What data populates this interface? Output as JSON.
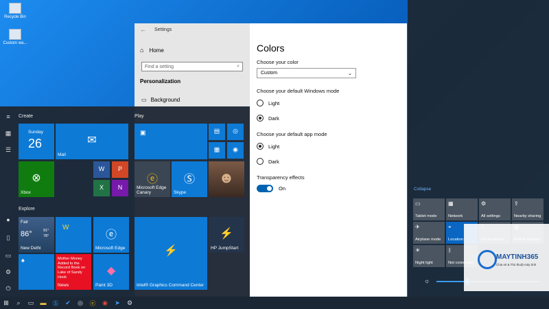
{
  "desktop": {
    "icons": [
      {
        "label": "Recycle Bin",
        "icon": "recycle-bin-icon"
      },
      {
        "label": "Custom wa...",
        "icon": "file-icon"
      }
    ]
  },
  "settings": {
    "window_title": "Settings",
    "home_label": "Home",
    "search_placeholder": "Find a setting",
    "section": "Personalization",
    "nav_item": "Background",
    "page_title": "Colors",
    "choose_color_label": "Choose your color",
    "choose_color_value": "Custom",
    "windows_mode_label": "Choose your default Windows mode",
    "windows_mode_options": [
      "Light",
      "Dark"
    ],
    "windows_mode_selected": "Dark",
    "app_mode_label": "Choose your default app mode",
    "app_mode_options": [
      "Light",
      "Dark"
    ],
    "app_mode_selected": "Light",
    "transparency_label": "Transparency effects",
    "transparency_state": "On"
  },
  "start_menu": {
    "group_create": "Create",
    "group_play": "Play",
    "group_explore": "Explore",
    "calendar": {
      "day": "Sunday",
      "date": "26"
    },
    "tiles": {
      "mail": "Mail",
      "xbox": "Xbox",
      "edge_canary": "Microsoft Edge Canary",
      "skype": "Skype",
      "weather_cond": "Fair",
      "weather_temp": "86°",
      "weather_hi": "91°",
      "weather_lo": "78°",
      "weather_city": "New Delhi",
      "edge": "Microsoft Edge",
      "news_headline": "Mother Money Added to the Record Book on Lake of Sandy Hook",
      "news": "News",
      "paint3d": "Paint 3D",
      "intel": "Intel® Graphics Command Center",
      "hp": "HP JumpStart"
    }
  },
  "action_center": {
    "collapse": "Collapse",
    "quick_actions": [
      {
        "label": "Tablet mode",
        "icon": "tablet-icon",
        "on": false
      },
      {
        "label": "Network",
        "icon": "network-icon",
        "on": false
      },
      {
        "label": "All settings",
        "icon": "gear-icon",
        "on": false
      },
      {
        "label": "Nearby sharing",
        "icon": "share-icon",
        "on": false
      },
      {
        "label": "Airplane mode",
        "icon": "airplane-icon",
        "on": false
      },
      {
        "label": "Location",
        "icon": "location-icon",
        "on": true
      },
      {
        "label": "Focus assist",
        "icon": "moon-icon",
        "on": false
      },
      {
        "label": "Mobile hotspot",
        "icon": "hotspot-icon",
        "on": false
      },
      {
        "label": "Night light",
        "icon": "night-light-icon",
        "on": false
      },
      {
        "label": "Not connected",
        "icon": "bluetooth-icon",
        "on": false
      }
    ],
    "brightness": 0.3
  },
  "watermark": {
    "brand": "MAYTINH365",
    "tagline": "Chia sẻ & Thủ thuật máy tính"
  }
}
